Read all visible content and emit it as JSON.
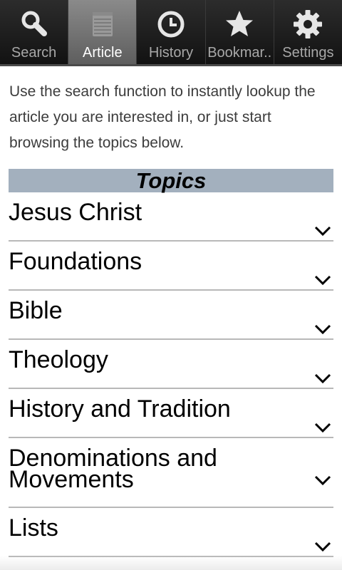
{
  "tabs": [
    {
      "label": "Search",
      "icon": "search-icon",
      "active": false
    },
    {
      "label": "Article",
      "icon": "notepad-icon",
      "active": true
    },
    {
      "label": "History",
      "icon": "clock-icon",
      "active": false
    },
    {
      "label": "Bookmar..",
      "icon": "star-icon",
      "active": false
    },
    {
      "label": "Settings",
      "icon": "gear-icon",
      "active": false
    }
  ],
  "intro": "Use the search function to instantly lookup the article you are interested in, or just start browsing the topics below.",
  "topics": {
    "header": "Topics",
    "items": [
      "Jesus Christ",
      "Foundations",
      "Bible",
      "Theology",
      "History and Tradition",
      "Denominations and Movements",
      "Lists"
    ]
  },
  "colors": {
    "tabbar_bg": "#1b1b1b",
    "active_tab": "#7a7a7a",
    "topics_header_bg": "#a3b0be"
  }
}
